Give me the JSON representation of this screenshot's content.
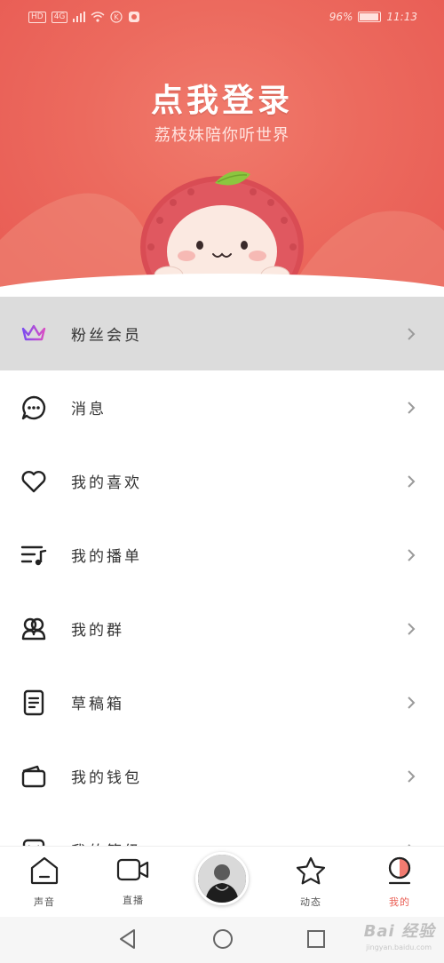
{
  "status_bar": {
    "left_badges": [
      "HD",
      "4G"
    ],
    "battery": "96%",
    "battery_level": 0.96,
    "time": "11:13"
  },
  "header": {
    "title": "点我登录",
    "subtitle": "荔枝妹陪你听世界",
    "mascot": "lychee-mascot"
  },
  "colors": {
    "header_red": "#ec6a5e",
    "accent": "#ea5e54",
    "crown_gradient": [
      "#7b4df0",
      "#d94dc4"
    ],
    "highlight_row": "#dcdcdc"
  },
  "menu": {
    "items": [
      {
        "label": "粉丝会员",
        "icon": "crown-icon"
      },
      {
        "label": "消息",
        "icon": "chat-bubble-icon"
      },
      {
        "label": "我的喜欢",
        "icon": "heart-icon"
      },
      {
        "label": "我的播单",
        "icon": "playlist-icon"
      },
      {
        "label": "我的群",
        "icon": "group-icon"
      },
      {
        "label": "草稿箱",
        "icon": "draft-icon"
      },
      {
        "label": "我的钱包",
        "icon": "wallet-icon"
      },
      {
        "label": "我的等级",
        "icon": "level-icon"
      }
    ]
  },
  "bottom_nav": {
    "items": [
      {
        "label": "声音",
        "icon": "home-icon"
      },
      {
        "label": "直播",
        "icon": "video-camera-icon"
      },
      {
        "label": "动态",
        "icon": "star-icon"
      },
      {
        "label": "我的",
        "icon": "profile-icon",
        "active": true
      }
    ]
  },
  "watermark": {
    "text": "Bai 经验",
    "sub": "jingyan.baidu.com"
  }
}
